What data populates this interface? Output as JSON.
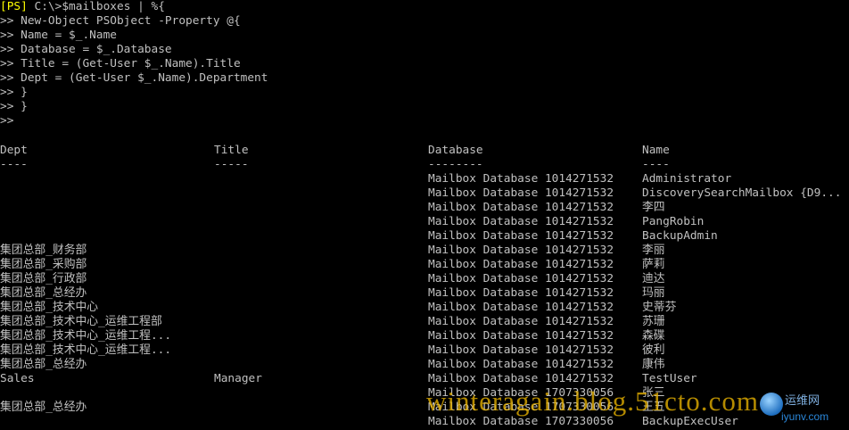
{
  "console": {
    "prompt_tag": "[PS]",
    "command_lines": [
      " C:\\>$mailboxes | %{",
      ">> New-Object PSObject -Property @{",
      ">> Name = $_.Name",
      ">> Database = $_.Database",
      ">> Title = (Get-User $_.Name).Title",
      ">> Dept = (Get-User $_.Name).Department",
      ">> }",
      ">> }",
      ">>"
    ],
    "headers": {
      "dept": "Dept",
      "title": "Title",
      "database": "Database",
      "name": "Name"
    },
    "underlines": {
      "dept": "----",
      "title": "-----",
      "database": "--------",
      "name": "----"
    },
    "rows": [
      {
        "dept": "",
        "title": "",
        "database": "Mailbox Database 1014271532",
        "name": "Administrator"
      },
      {
        "dept": "",
        "title": "",
        "database": "Mailbox Database 1014271532",
        "name": "DiscoverySearchMailbox {D9..."
      },
      {
        "dept": "",
        "title": "",
        "database": "Mailbox Database 1014271532",
        "name": "李四"
      },
      {
        "dept": "",
        "title": "",
        "database": "Mailbox Database 1014271532",
        "name": "PangRobin"
      },
      {
        "dept": "",
        "title": "",
        "database": "Mailbox Database 1014271532",
        "name": "BackupAdmin"
      },
      {
        "dept": "集团总部_财务部",
        "title": "",
        "database": "Mailbox Database 1014271532",
        "name": "李丽"
      },
      {
        "dept": "集团总部_采购部",
        "title": "",
        "database": "Mailbox Database 1014271532",
        "name": "萨莉"
      },
      {
        "dept": "集团总部_行政部",
        "title": "",
        "database": "Mailbox Database 1014271532",
        "name": "迪达"
      },
      {
        "dept": "集团总部_总经办",
        "title": "",
        "database": "Mailbox Database 1014271532",
        "name": "玛丽"
      },
      {
        "dept": "集团总部_技术中心",
        "title": "",
        "database": "Mailbox Database 1014271532",
        "name": "史蒂芬"
      },
      {
        "dept": "集团总部_技术中心_运维工程部",
        "title": "",
        "database": "Mailbox Database 1014271532",
        "name": "苏珊"
      },
      {
        "dept": "集团总部_技术中心_运维工程...",
        "title": "",
        "database": "Mailbox Database 1014271532",
        "name": "森碟"
      },
      {
        "dept": "集团总部_技术中心_运维工程...",
        "title": "",
        "database": "Mailbox Database 1014271532",
        "name": "彼利"
      },
      {
        "dept": "集团总部_总经办",
        "title": "",
        "database": "Mailbox Database 1014271532",
        "name": "康伟"
      },
      {
        "dept": "Sales",
        "title": "Manager",
        "database": "Mailbox Database 1014271532",
        "name": "TestUser"
      },
      {
        "dept": "",
        "title": "",
        "database": "Mailbox Database 1707330056",
        "name": "张三"
      },
      {
        "dept": "集团总部_总经办",
        "title": "",
        "database": "Mailbox Database 1707330056",
        "name": "王五"
      },
      {
        "dept": "",
        "title": "",
        "database": "Mailbox Database 1707330056",
        "name": "BackupExecUser"
      }
    ]
  },
  "watermark": {
    "text": "winteragain.blog.51cto.com"
  },
  "logo": {
    "cn_text": "运维网",
    "url_text": "iyunv.com"
  }
}
